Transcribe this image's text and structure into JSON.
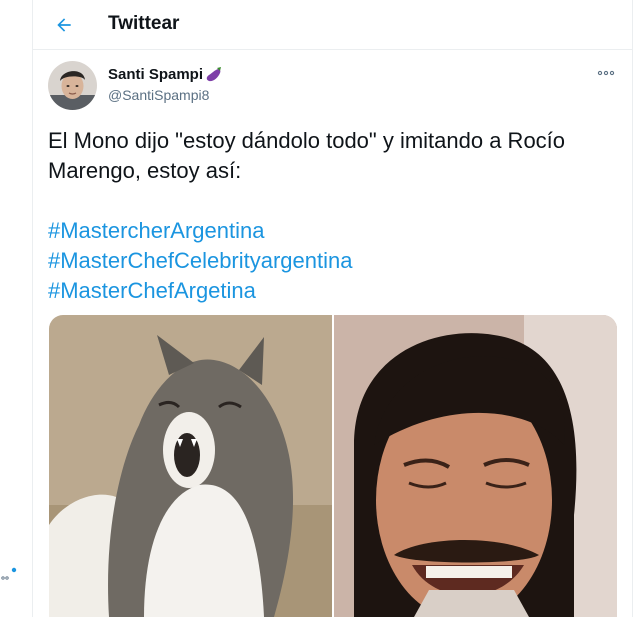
{
  "header": {
    "title": "Twittear",
    "back_icon": "arrow-left-icon"
  },
  "tweet": {
    "author_name": "Santi Spampi",
    "author_emoji": "eggplant-icon",
    "author_handle": "@SantiSpampi8",
    "more_icon": "more-horizontal-icon",
    "text_lines": [
      "El Mono dijo \"estoy dándolo todo\" y imitando a Rocío",
      "Marengo, estoy así:"
    ],
    "hashtags": [
      "#MastercherArgentina",
      "#MasterChefCelebrityargentina",
      "#MasterChefArgetina"
    ]
  },
  "colors": {
    "accent": "#1b95e0",
    "secondary_text": "#5b7083",
    "border": "#ebeef0"
  }
}
